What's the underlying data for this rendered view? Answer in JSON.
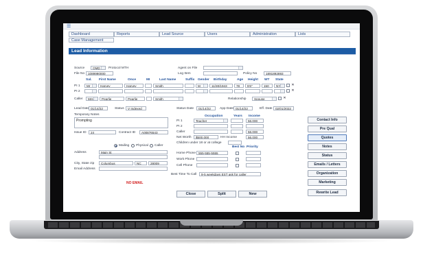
{
  "nav": {
    "tabs": [
      "Dashboard",
      "Reports",
      "Lead Source",
      "Users",
      "Administration",
      "Lists"
    ],
    "row2": [
      "Case Management"
    ]
  },
  "section_title": "Lead Information",
  "lead": {
    "source_label": "Source",
    "source_value": "OMD",
    "source_note": "Protocol MTH",
    "agent_label": "Agent on File",
    "file_no_label": "File No",
    "file_no_value": "1089990000",
    "log_item_label": "Log Item",
    "policy_no_label": "Policy No",
    "policy_no_value": "1891892893"
  },
  "columns": [
    "Sal.",
    "First Name",
    "Once",
    "MI",
    "Last Name",
    "Suffix",
    "Gender",
    "Birthday",
    "Age",
    "Height",
    "WT",
    "State"
  ],
  "persons": [
    {
      "label": "PI 1",
      "sal": "Mr",
      "first": "Harvey",
      "once": "Harvey",
      "mi": "",
      "last": "Smith",
      "suffix": "",
      "gender": "M",
      "birthday": "11/30/1943",
      "age": "78",
      "height": "5'6\"",
      "wt": "150",
      "state": "NY"
    },
    {
      "label": "PI 2",
      "sal": "",
      "first": "",
      "once": "",
      "mi": "",
      "last": "",
      "suffix": "",
      "gender": "",
      "birthday": "",
      "age": "",
      "height": "",
      "wt": "",
      "state": ""
    }
  ],
  "caller": {
    "label": "Caller",
    "sal": "Mrs",
    "first": "Pearlie",
    "once": "Pearlie",
    "last": "Smith",
    "relationship_label": "Relationship",
    "relationship_value": "Spouse"
  },
  "dates": {
    "lead_date_label": "Lead Date",
    "lead_date_value": "01/14/22",
    "status_label": "Status",
    "status_value": "V   Indexed",
    "status_date_label": "Status Date",
    "status_date_value": "01/14/22",
    "app_date_label": "App Date",
    "app_date_value": "01/14/22",
    "eff_date_label": "Eff. Date",
    "eff_date_value": "02/01/2022"
  },
  "notes": {
    "label": "Temporary Notes",
    "value": "Prompting"
  },
  "ids": {
    "issue_label": "Issue ID",
    "issue_value": "24",
    "contract_label": "Contract ID",
    "contract_value": "A00876543"
  },
  "occupation": {
    "headers": [
      "Occupation",
      "Years",
      "Income"
    ],
    "rows": [
      {
        "label": "PI 1",
        "occupation": "Teacher",
        "years": "",
        "income": "56,000"
      },
      {
        "label": "PI 2",
        "occupation": "",
        "years": "",
        "income": ""
      },
      {
        "label": "Caller",
        "occupation": "",
        "years": "",
        "income": "56,000"
      }
    ],
    "net_worth_label": "Net Worth",
    "net_worth_value": "$500,000",
    "hh_income_label": "HH Income",
    "hh_income_value": "56,000",
    "children_label": "Children under 18 or at college"
  },
  "address": {
    "mailing": "Mailing",
    "physical": "Physical",
    "caller": "Caller",
    "address_label": "Address",
    "address_value": "Main St",
    "city_label": "City, State zip",
    "city_value": "Columbus",
    "state_value": "NC",
    "zip_value": "28009",
    "email_label": "Email Address",
    "no_email": "NO EMAIL"
  },
  "phones": {
    "best_no": "Best No",
    "priority": "Priority",
    "home_label": "Home Phone",
    "home_value": "555-555-5555",
    "work_label": "Work Phone",
    "cell_label": "Cell Phone",
    "best_time_label": "Best Time To Call",
    "best_time_value": "9-5 weekdays EST ask for caller"
  },
  "side_buttons": [
    "Contact Info",
    "Pre Qual",
    "Quotes",
    "Notes",
    "Status",
    "Emails / Letters",
    "Organization",
    "Marketing",
    "Rewrite Lead"
  ],
  "bottom_buttons": [
    "Close",
    "Split",
    "New"
  ]
}
